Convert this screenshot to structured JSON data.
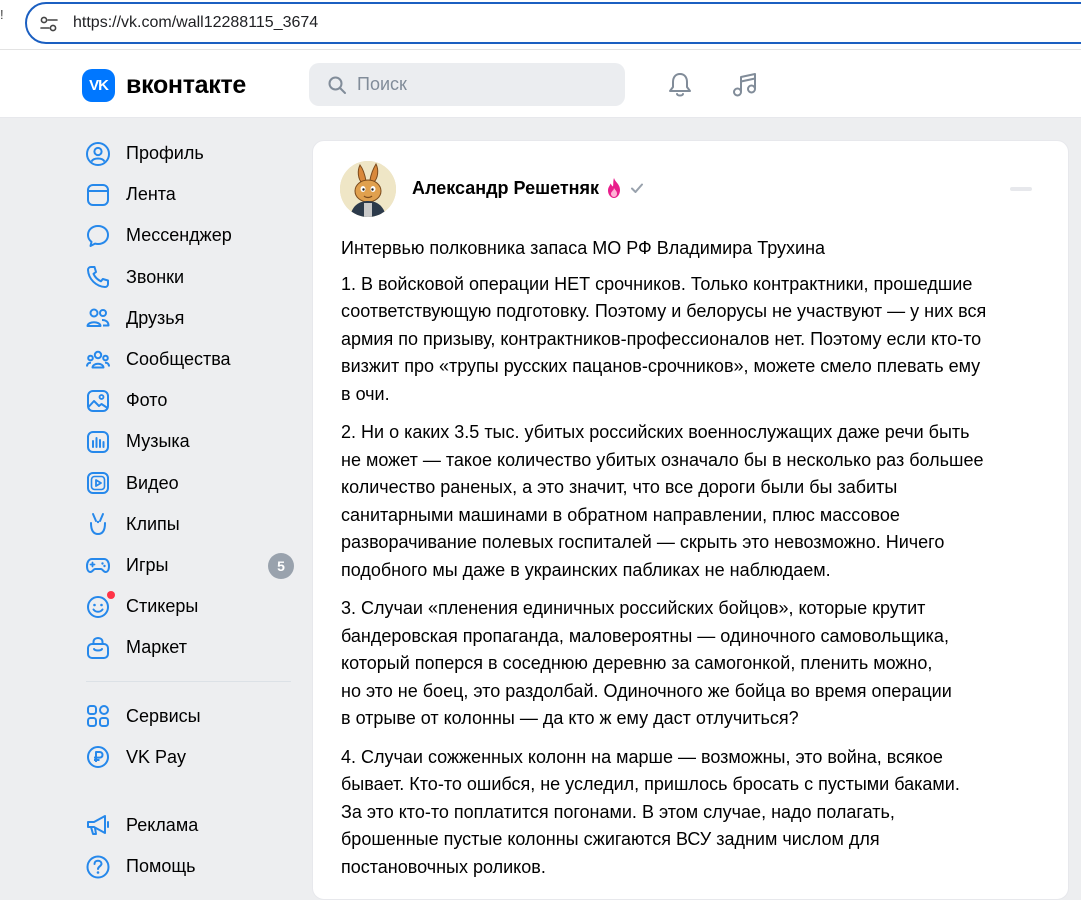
{
  "browser": {
    "url": "https://vk.com/wall12288115_3674",
    "left_mark": "!"
  },
  "header": {
    "logo_text": "вконтакте",
    "logo_mark": "VK",
    "search_placeholder": "Поиск",
    "icons": [
      "bell-icon",
      "music-note-icon"
    ],
    "brand_color": "#0077ff"
  },
  "sidebar": {
    "items": [
      {
        "label": "Профиль",
        "icon": "profile-icon"
      },
      {
        "label": "Лента",
        "icon": "feed-icon"
      },
      {
        "label": "Мессенджер",
        "icon": "messenger-icon"
      },
      {
        "label": "Звонки",
        "icon": "phone-icon"
      },
      {
        "label": "Друзья",
        "icon": "friends-icon"
      },
      {
        "label": "Сообщества",
        "icon": "communities-icon"
      },
      {
        "label": "Фото",
        "icon": "photo-icon"
      },
      {
        "label": "Музыка",
        "icon": "music-icon"
      },
      {
        "label": "Видео",
        "icon": "video-icon"
      },
      {
        "label": "Клипы",
        "icon": "clips-icon"
      },
      {
        "label": "Игры",
        "icon": "games-icon",
        "badge": "5"
      },
      {
        "label": "Стикеры",
        "icon": "stickers-icon"
      },
      {
        "label": "Маркет",
        "icon": "market-icon"
      }
    ],
    "secondary": [
      {
        "label": "Сервисы",
        "icon": "services-icon"
      },
      {
        "label": "VK Pay",
        "icon": "vkpay-icon"
      }
    ],
    "tertiary": [
      {
        "label": "Реклама",
        "icon": "ads-icon"
      },
      {
        "label": "Помощь",
        "icon": "help-icon"
      }
    ]
  },
  "post": {
    "author": "Александр Решетняк",
    "title": "Интервью полковника запаса МО РФ Владимира Трухина",
    "paragraphs": [
      [
        "1. В войсковой операции НЕТ срочников. Только контрактники, прошедшие",
        "соответствующую подготовку. Поэтому и белорусы не участвуют — у них вся",
        "армия по призыву, контрактников-профессионалов нет. Поэтому если кто-то",
        "визжит про «трупы русских пацанов-срочников», можете смело плевать ему",
        "в очи."
      ],
      [
        "2. Ни о каких 3.5 тыс. убитых российских военнослужащих даже речи быть",
        "не может — такое количество убитых означало бы в несколько раз большее",
        "количество раненых, а это значит, что все дороги были бы забиты",
        "санитарными машинами в обратном направлении, плюс массовое",
        "разворачивание полевых госпиталей — скрыть это невозможно. Ничего",
        "подобного мы даже в украинских пабликах не наблюдаем."
      ],
      [
        "3. Случаи «пленения единичных российских бойцов», которые крутит",
        "бандеровская пропаганда, маловероятны — одиночного самовольщика,",
        "который поперся в соседнюю деревню за самогонкой, пленить можно,",
        "но это не боец, это раздолбай. Одиночного же бойца во время операции",
        "в отрыве от колонны — да кто ж ему даст отлучиться?"
      ],
      [
        "4. Случаи сожженных колонн на марше — возможны, это война, всякое",
        "бывает. Кто-то ошибся, не уследил, пришлось бросать с пустыми баками.",
        "За это кто-то поплатится погонами. В этом случае, надо полагать,",
        "брошенные пустые колонны сжигаются ВСУ задним числом для",
        "постановочных роликов."
      ]
    ]
  }
}
